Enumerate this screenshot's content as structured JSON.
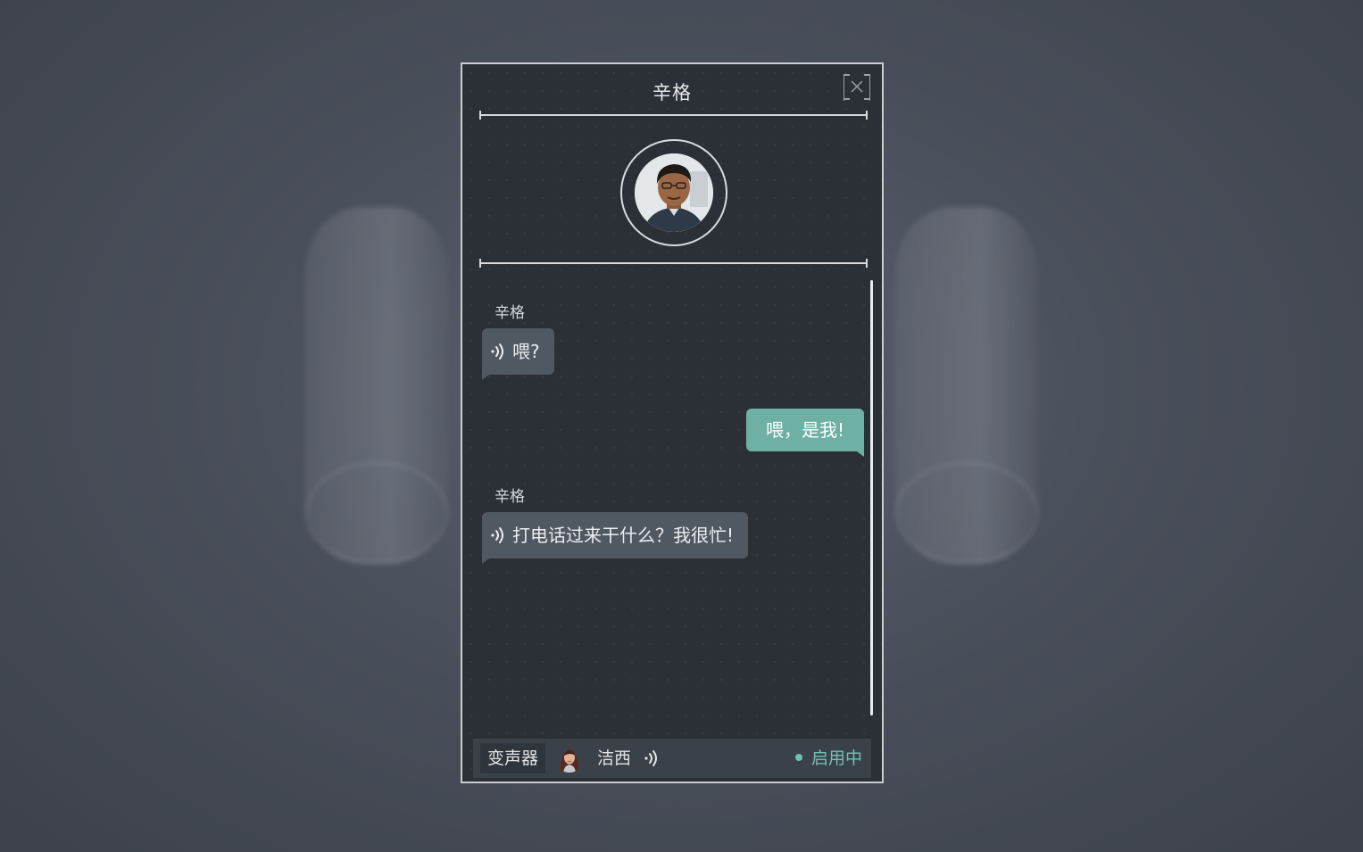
{
  "call": {
    "contact_name": "辛格",
    "avatar_icon": "man-portrait-avatar",
    "close_icon": "close-x-icon"
  },
  "messages": [
    {
      "sender": "辛格",
      "direction": "incoming",
      "text": "喂?",
      "voice": true
    },
    {
      "sender": "",
      "direction": "outgoing",
      "text": "喂，是我!",
      "voice": false
    },
    {
      "sender": "辛格",
      "direction": "incoming",
      "text": "打电话过来干什么？我很忙!",
      "voice": true
    }
  ],
  "voice_changer": {
    "label": "变声器",
    "voice_name": "洁西",
    "avatar_icon": "woman-portrait-avatar",
    "status": "启用中",
    "status_color": "#6fc2b2"
  },
  "colors": {
    "incoming_bubble": "#505862",
    "outgoing_bubble": "#6fb0a4",
    "panel_bg": "#2b3036"
  }
}
